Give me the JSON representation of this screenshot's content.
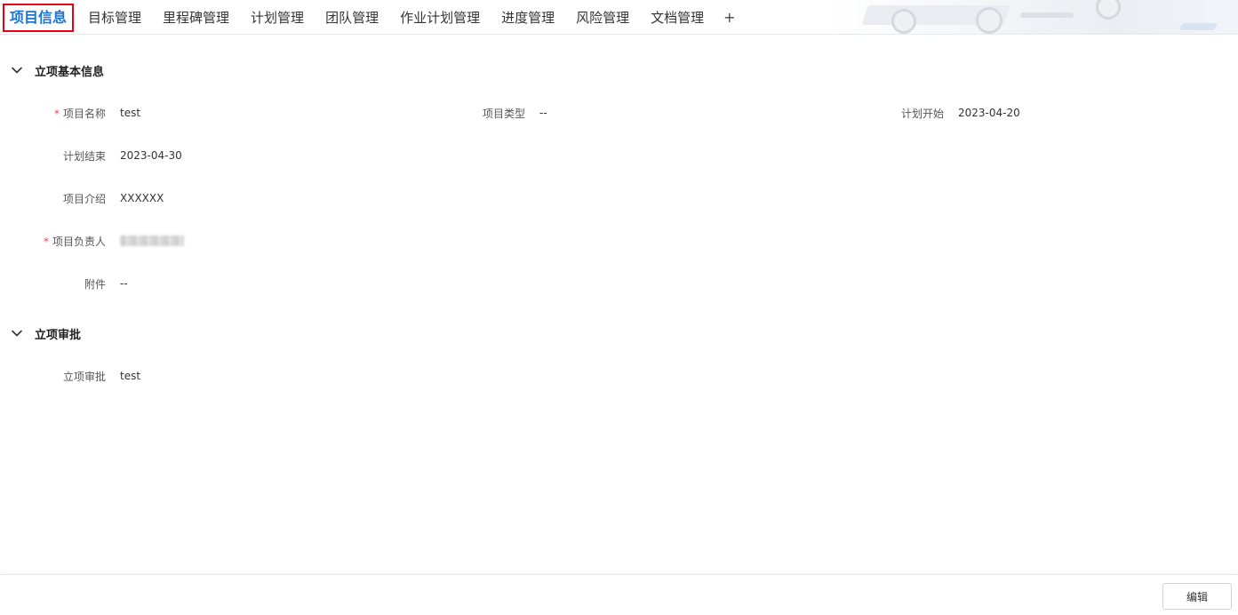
{
  "tabs": [
    {
      "label": "项目信息",
      "active": true
    },
    {
      "label": "目标管理"
    },
    {
      "label": "里程碑管理"
    },
    {
      "label": "计划管理"
    },
    {
      "label": "团队管理"
    },
    {
      "label": "作业计划管理"
    },
    {
      "label": "进度管理"
    },
    {
      "label": "风险管理"
    },
    {
      "label": "文档管理"
    }
  ],
  "tab_add_label": "+",
  "colors": {
    "active_tab": "#1a73d9",
    "active_outline": "#e60012",
    "required_mark": "#e34d59"
  },
  "basic_info": {
    "title": "立项基本信息",
    "fields": {
      "project_name": {
        "label": "项目名称",
        "value": "test",
        "required": true
      },
      "project_type": {
        "label": "项目类型",
        "value": "--"
      },
      "plan_start": {
        "label": "计划开始",
        "value": "2023-04-20"
      },
      "plan_end": {
        "label": "计划结束",
        "value": "2023-04-30"
      },
      "project_intro": {
        "label": "项目介绍",
        "value": "XXXXXX"
      },
      "project_owner": {
        "label": "项目负责人",
        "value_redacted": true,
        "required": true
      },
      "attachment": {
        "label": "附件",
        "value": "--"
      }
    }
  },
  "approval": {
    "title": "立项审批",
    "fields": {
      "approval": {
        "label": "立项审批",
        "value": "test"
      }
    }
  },
  "required_mark": "*",
  "footer": {
    "edit_label": "编辑"
  }
}
